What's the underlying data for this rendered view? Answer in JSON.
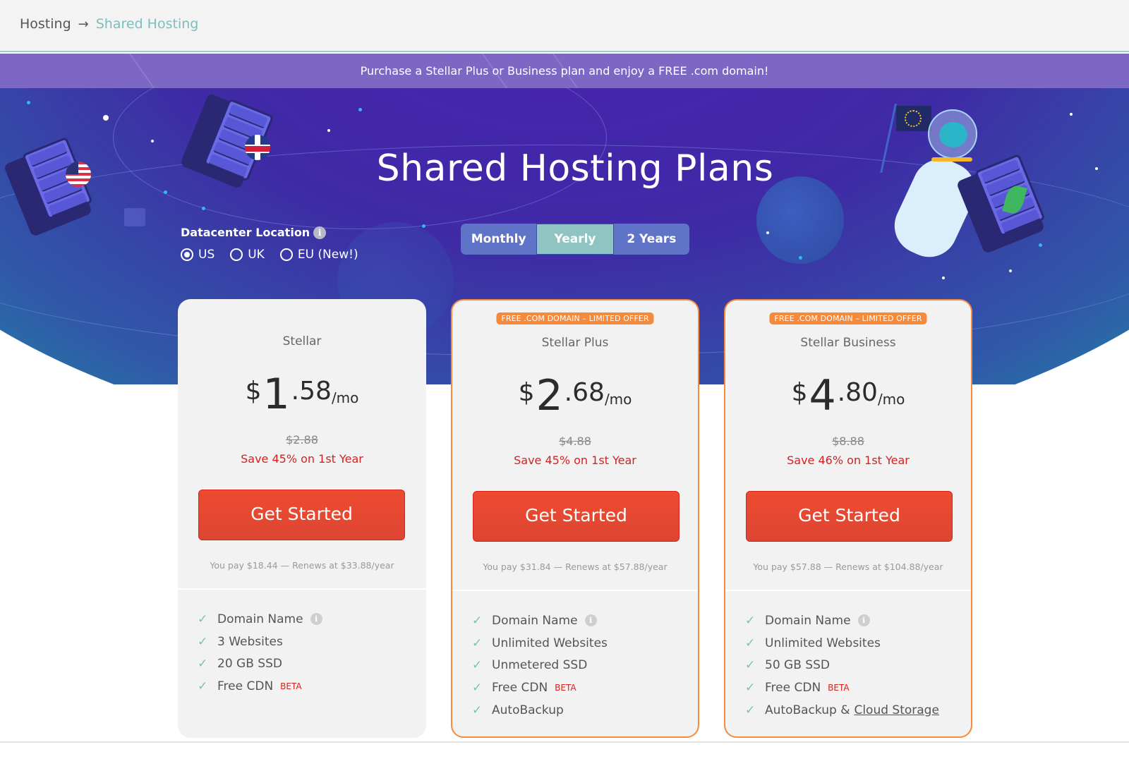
{
  "breadcrumb": {
    "root": "Hosting",
    "separator": "→",
    "current": "Shared Hosting"
  },
  "promo_banner": "Purchase a Stellar Plus or Business plan and enjoy a FREE .com domain!",
  "hero": {
    "title": "Shared Hosting Plans",
    "datacenter": {
      "label": "Datacenter Location",
      "info_icon": "info-icon",
      "options": [
        {
          "label": "US",
          "selected": true
        },
        {
          "label": "UK",
          "selected": false
        },
        {
          "label": "EU (New!)",
          "selected": false
        }
      ]
    },
    "term_toggle": {
      "options": [
        {
          "label": "Monthly",
          "active": false
        },
        {
          "label": "Yearly",
          "active": true
        },
        {
          "label": "2 Years",
          "active": false
        }
      ]
    }
  },
  "colors": {
    "accent_teal": "#7ebdbf",
    "cta_red": "#e54a30",
    "offer_orange": "#f7893a",
    "savings_red": "#d81f1f",
    "promo_purple": "#7c67c4"
  },
  "plans": [
    {
      "name": "Stellar",
      "badge": null,
      "featured": false,
      "price_symbol": "$",
      "price_int": "1",
      "price_dec": ".58",
      "price_unit": "/mo",
      "old_price": "$2.88",
      "savings": "Save 45% on 1st Year",
      "cta": "Get Started",
      "pay_note": "You pay $18.44 — Renews at $33.88/year",
      "features": [
        {
          "text": "Domain Name",
          "info": true
        },
        {
          "text": "3 Websites"
        },
        {
          "text": "20 GB SSD"
        },
        {
          "text": "Free CDN",
          "tag": "BETA"
        }
      ]
    },
    {
      "name": "Stellar Plus",
      "badge": "FREE .COM DOMAIN – LIMITED OFFER",
      "featured": true,
      "price_symbol": "$",
      "price_int": "2",
      "price_dec": ".68",
      "price_unit": "/mo",
      "old_price": "$4.88",
      "savings": "Save 45% on 1st Year",
      "cta": "Get Started",
      "pay_note": "You pay $31.84 — Renews at $57.88/year",
      "features": [
        {
          "text": "Domain Name",
          "info": true
        },
        {
          "text": "Unlimited Websites"
        },
        {
          "text": "Unmetered SSD"
        },
        {
          "text": "Free CDN",
          "tag": "BETA"
        },
        {
          "text": "AutoBackup"
        }
      ]
    },
    {
      "name": "Stellar Business",
      "badge": "FREE .COM DOMAIN – LIMITED OFFER",
      "featured": true,
      "price_symbol": "$",
      "price_int": "4",
      "price_dec": ".80",
      "price_unit": "/mo",
      "old_price": "$8.88",
      "savings": "Save 46% on 1st Year",
      "cta": "Get Started",
      "pay_note": "You pay $57.88 — Renews at $104.88/year",
      "features": [
        {
          "text": "Domain Name",
          "info": true
        },
        {
          "text": "Unlimited Websites"
        },
        {
          "text": "50 GB SSD"
        },
        {
          "text": "Free CDN",
          "tag": "BETA"
        },
        {
          "text": "AutoBackup &",
          "link": "Cloud Storage"
        }
      ]
    }
  ]
}
